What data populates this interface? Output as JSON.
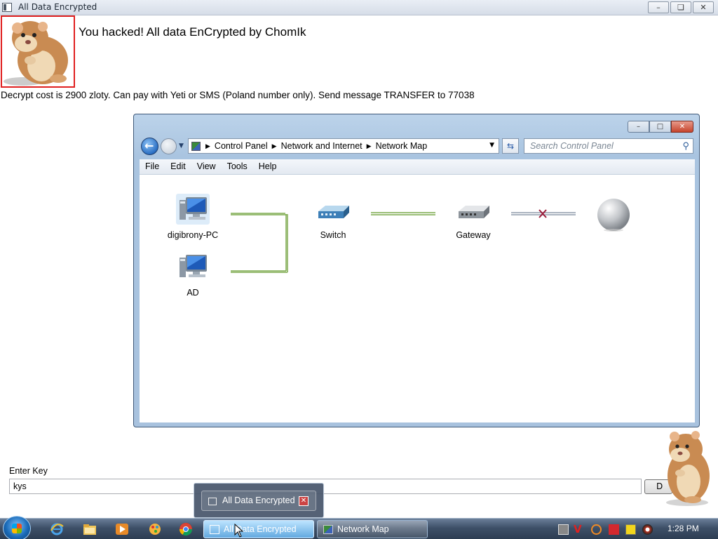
{
  "app": {
    "title": "All Data Encrypted",
    "controls": {
      "minimize": "–",
      "maximize": "❏",
      "close": "✕"
    }
  },
  "ransom": {
    "headline": "You hacked! All data EnCrypted by ChomIk",
    "message": "Decrypt cost is 2900 zloty. Can pay with Yeti or SMS (Poland number only). Send message TRANSFER to 77038"
  },
  "network_window": {
    "breadcrumbs": [
      "Control Panel",
      "Network and Internet",
      "Network Map"
    ],
    "search_placeholder": "Search Control Panel",
    "menu": [
      "File",
      "Edit",
      "View",
      "Tools",
      "Help"
    ],
    "nodes": {
      "pc": "digibrony-PC",
      "ad": "AD",
      "switch": "Switch",
      "gateway": "Gateway"
    },
    "colors": {
      "link": "#7aa84a",
      "broken": "#9b1c3a"
    }
  },
  "key_form": {
    "label": "Enter Key",
    "value": "kys",
    "button": "D"
  },
  "thumbnail": {
    "title": "All Data Encrypted"
  },
  "taskbar": {
    "tasks": [
      "All Data Encrypted",
      "Network Map"
    ],
    "clock": "1:28 PM"
  }
}
